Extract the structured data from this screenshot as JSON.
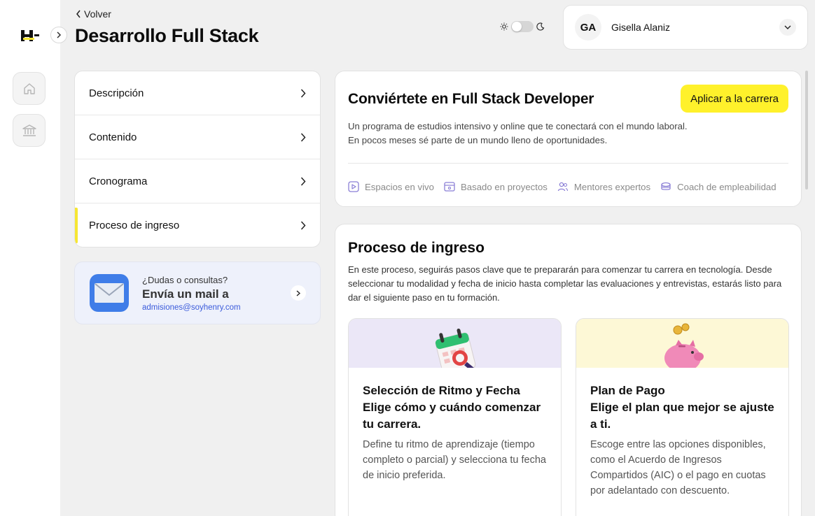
{
  "nav": {
    "back_label": "Volver",
    "page_title": "Desarrollo Full Stack"
  },
  "user": {
    "initials": "GA",
    "name": "Gisella Alaniz"
  },
  "side_menu": {
    "items": [
      {
        "label": "Descripción"
      },
      {
        "label": "Contenido"
      },
      {
        "label": "Cronograma"
      },
      {
        "label": "Proceso de ingreso",
        "active": true
      }
    ]
  },
  "contact": {
    "question": "¿Dudas o consultas?",
    "main": "Envía un mail a",
    "email": "admisiones@soyhenry.com"
  },
  "hero": {
    "title": "Conviértete en Full Stack Developer",
    "apply_label": "Aplicar a la carrera",
    "desc_line1": "Un programa de estudios intensivo y online que te conectará con el mundo laboral.",
    "desc_line2": "En pocos meses sé parte de un mundo lleno de oportunidades.",
    "features": [
      {
        "label": "Espacios en vivo",
        "icon": "play-icon"
      },
      {
        "label": "Basado en proyectos",
        "icon": "project-icon"
      },
      {
        "label": "Mentores expertos",
        "icon": "users-icon"
      },
      {
        "label": "Coach de empleabilidad",
        "icon": "coins-icon"
      }
    ]
  },
  "process": {
    "title": "Proceso de ingreso",
    "desc": "En este proceso, seguirás pasos clave que te prepararán para comenzar tu carrera en tecnología. Desde seleccionar tu modalidad y fecha de inicio hasta completar las evaluaciones y entrevistas, estarás listo para dar el siguiente paso en tu formación.",
    "steps": [
      {
        "heading_line1": "Selección de Ritmo y Fecha",
        "heading_line2": "Elige cómo y cuándo comenzar tu carrera.",
        "text": "Define tu ritmo de aprendizaje (tiempo completo o parcial) y selecciona tu fecha de inicio preferida.",
        "icon": "calendar-icon"
      },
      {
        "heading_line1": "Plan de Pago",
        "heading_line2": "Elige el plan que mejor se ajuste a ti.",
        "text": "Escoge entre las opciones disponibles, como el Acuerdo de Ingresos Compartidos (AIC) o el pago en cuotas por adelantado con descuento.",
        "icon": "piggy-bank-icon"
      }
    ]
  },
  "colors": {
    "accent_yellow": "#fff12b",
    "active_indicator": "#f6e633",
    "link_blue": "#3b5bdb",
    "feature_icon": "#8b7fd6"
  }
}
